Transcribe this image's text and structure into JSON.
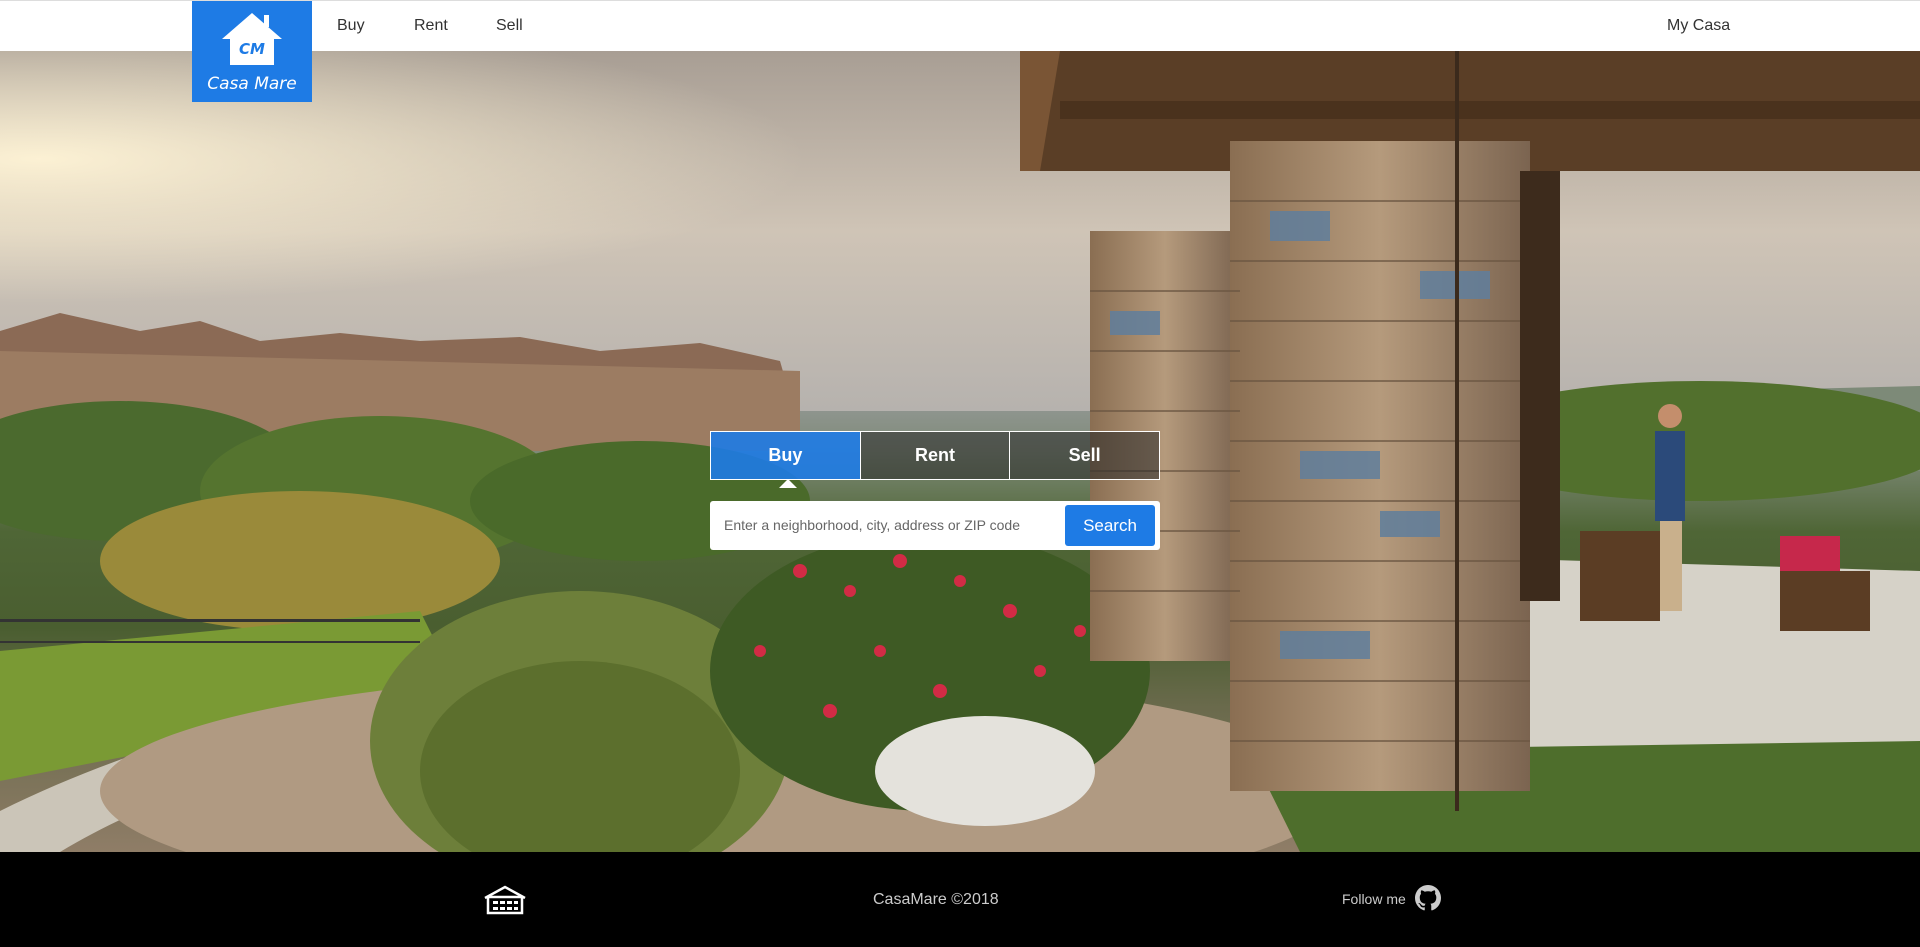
{
  "brand": {
    "monogram": "CM",
    "name": "Casa Mare",
    "color": "#1e7be5"
  },
  "nav": {
    "buy": "Buy",
    "rent": "Rent",
    "sell": "Sell",
    "my_casa": "My Casa"
  },
  "search": {
    "tabs": [
      "Buy",
      "Rent",
      "Sell"
    ],
    "active_tab": "Buy",
    "placeholder": "Enter a neighborhood, city, address or ZIP code",
    "button_label": "Search"
  },
  "footer": {
    "icon": "house-icon",
    "copyright": "CasaMare ©2018",
    "follow_label": "Follow me",
    "social_icon": "github-icon"
  }
}
